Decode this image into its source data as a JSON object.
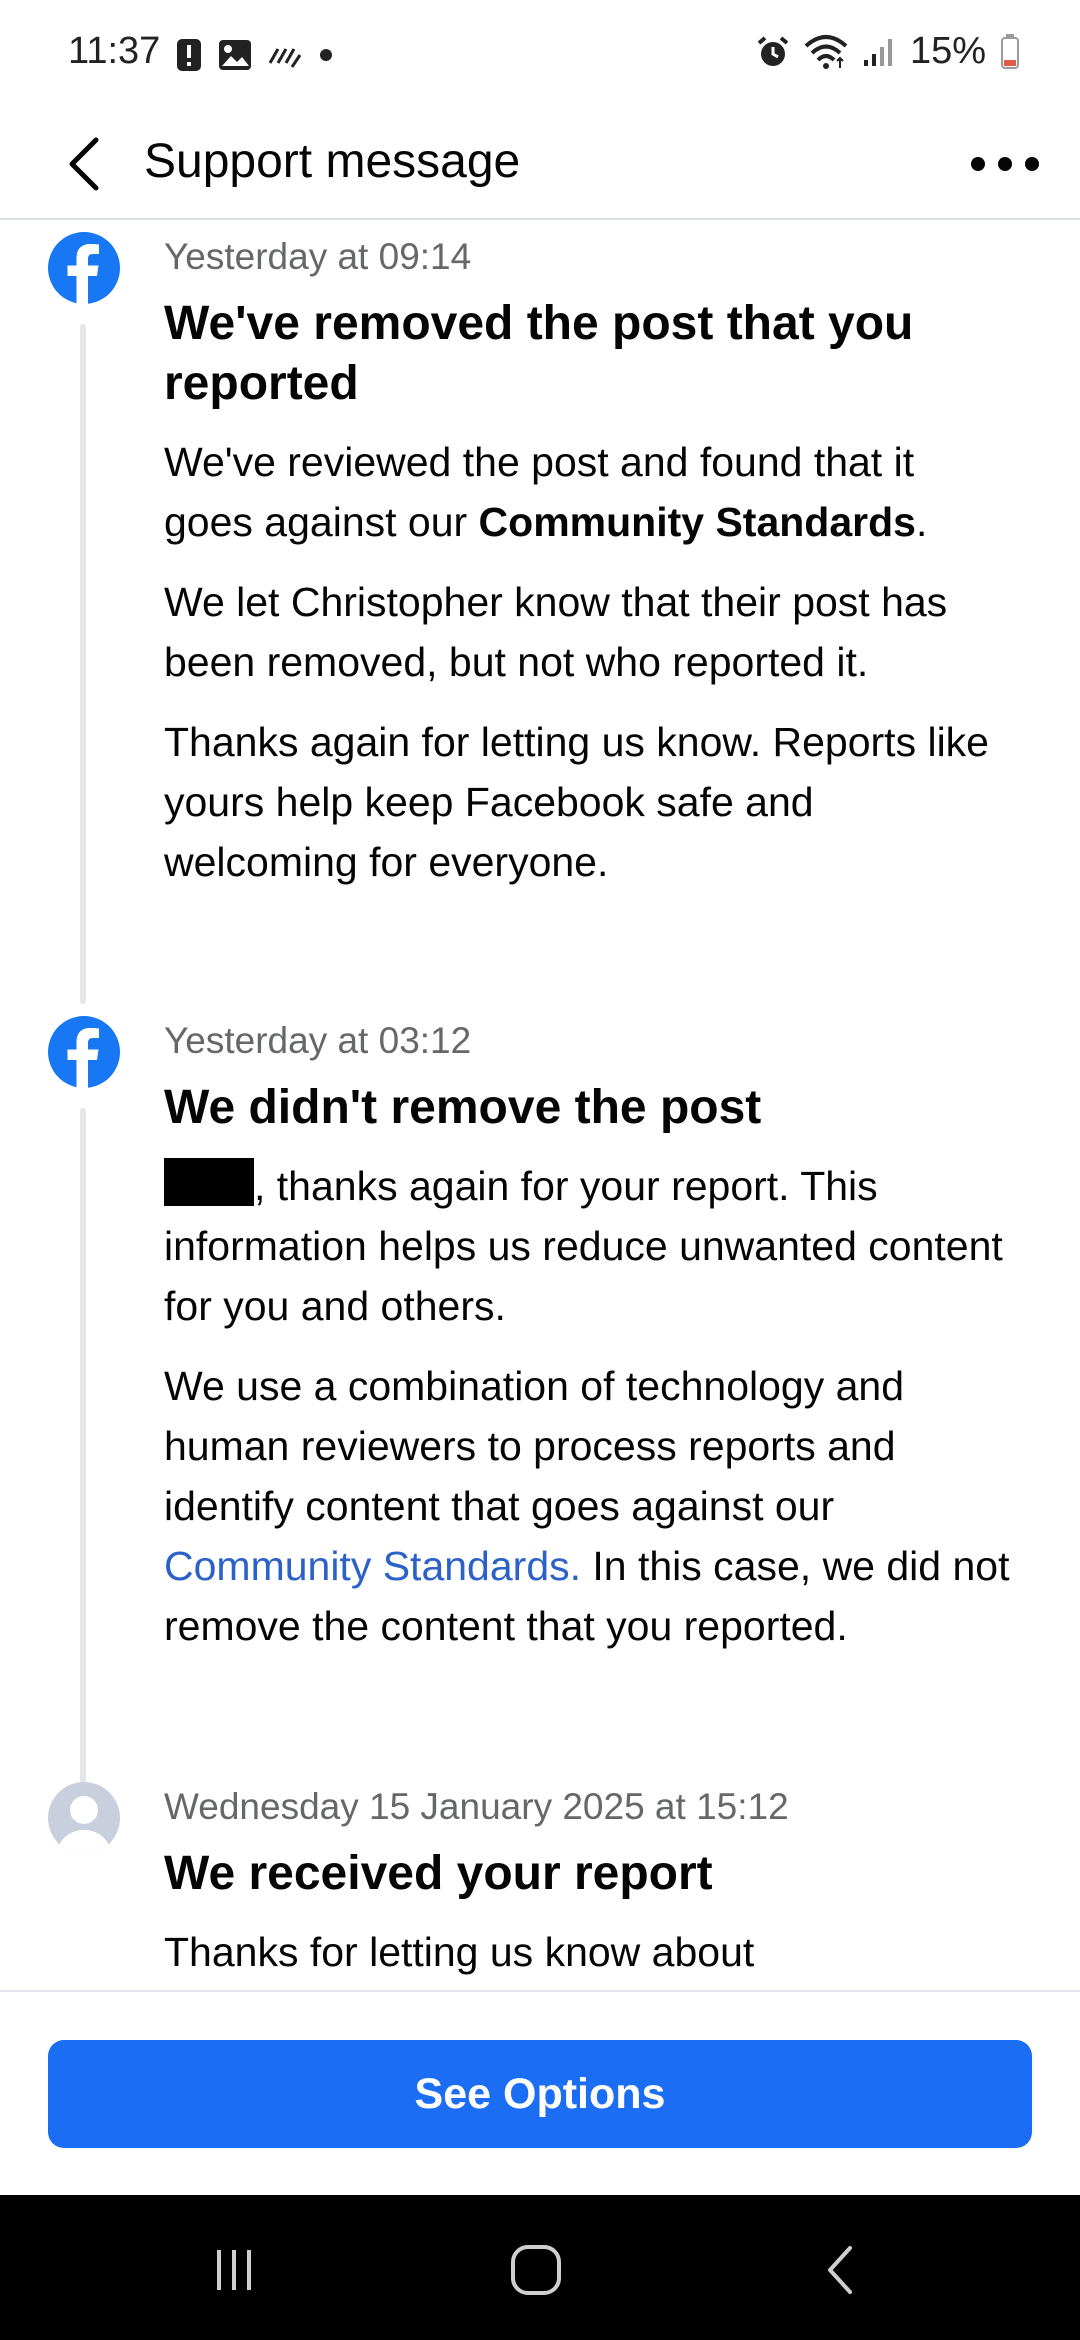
{
  "status_bar": {
    "time": "11:37",
    "battery": "15%",
    "icons_left": [
      "alert-icon",
      "image-icon",
      "signal-activity-icon",
      "dot-icon"
    ],
    "icons_right": [
      "alarm-icon",
      "wifi-icon",
      "cell-signal-icon",
      "battery-icon"
    ]
  },
  "header": {
    "title": "Support message"
  },
  "messages": [
    {
      "timestamp": "Yesterday at 09:14",
      "title": "We've removed the post that you reported",
      "p1_a": "We've reviewed the post and found that it goes against our ",
      "p1_bold": "Community Standards",
      "p1_b": ".",
      "p2": "We let Christopher know that their post has been removed, but not who reported it.",
      "p3": "Thanks again for letting us know. Reports like yours help keep Facebook safe and welcoming for everyone."
    },
    {
      "timestamp": "Yesterday at 03:12",
      "title": "We didn't remove the post",
      "p1": ", thanks again for your report. This information helps us reduce unwanted content for you and others.",
      "p2_a": "We use a combination of technology and human reviewers to process reports and identify content that goes against our ",
      "p2_link": "Community Standards.",
      "p2_b": " In this case, we did not remove the content that you reported."
    },
    {
      "timestamp": "Wednesday 15 January 2025 at 15:12",
      "title": "We received your report",
      "p1": "Thanks for letting us know about"
    }
  ],
  "footer": {
    "button_label": "See Options"
  },
  "colors": {
    "facebook_blue": "#1877f2",
    "button_blue": "#1b6ef3",
    "link_blue": "#2b61c8",
    "timestamp_gray": "#65676b"
  }
}
